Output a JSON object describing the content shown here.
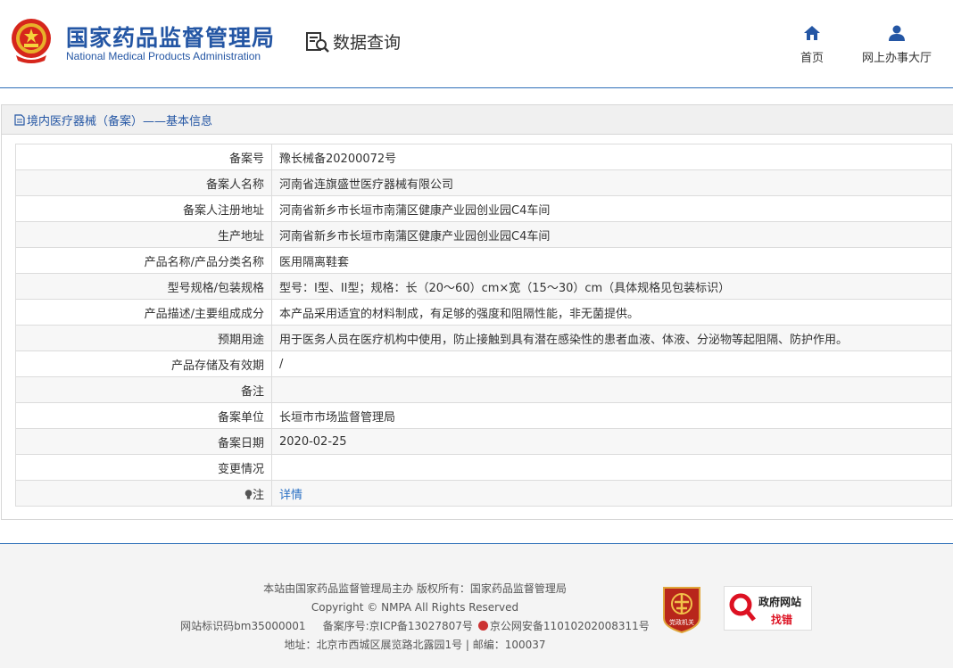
{
  "header": {
    "title_cn": "国家药品监督管理局",
    "title_en": "National Medical Products Administration",
    "query_label": "数据查询",
    "nav": [
      {
        "label": "首页",
        "icon": "home-icon"
      },
      {
        "label": "网上办事大厅",
        "icon": "user-icon"
      }
    ]
  },
  "panel": {
    "title": "境内医疗器械（备案）——基本信息",
    "rows": [
      {
        "label": "备案号",
        "value": "豫长械备20200072号"
      },
      {
        "label": "备案人名称",
        "value": "河南省连旗盛世医疗器械有限公司"
      },
      {
        "label": "备案人注册地址",
        "value": "河南省新乡市长垣市南蒲区健康产业园创业园C4车间"
      },
      {
        "label": "生产地址",
        "value": "河南省新乡市长垣市南蒲区健康产业园创业园C4车间"
      },
      {
        "label": "产品名称/产品分类名称",
        "value": "医用隔离鞋套"
      },
      {
        "label": "型号规格/包装规格",
        "value": "型号：I型、II型；规格：长（20～60）cm×宽（15～30）cm（具体规格见包装标识）"
      },
      {
        "label": "产品描述/主要组成成分",
        "value": "本产品采用适宜的材料制成，有足够的强度和阻隔性能，非无菌提供。"
      },
      {
        "label": "预期用途",
        "value": "用于医务人员在医疗机构中使用，防止接触到具有潜在感染性的患者血液、体液、分泌物等起阻隔、防护作用。"
      },
      {
        "label": "产品存储及有效期",
        "value": "/"
      },
      {
        "label": "备注",
        "value": ""
      },
      {
        "label": "备案单位",
        "value": "长垣市市场监督管理局"
      },
      {
        "label": "备案日期",
        "value": "2020-02-25"
      },
      {
        "label": "变更情况",
        "value": ""
      },
      {
        "label": "注",
        "value": "详情"
      }
    ]
  },
  "footer": {
    "line1": "本站由国家药品监督管理局主办 版权所有：国家药品监督管理局",
    "line2": "Copyright © NMPA All Rights Reserved",
    "site_id": "网站标识码bm35000001",
    "icp": "备案序号:京ICP备13027807号",
    "police": "京公网安备11010202008311号",
    "address": "地址：北京市西城区展览路北露园1号 | 邮编：100037",
    "badge1_text": "党政机关",
    "badge2_line1": "政府网站",
    "badge2_line2": "找错"
  },
  "colors": {
    "brand": "#2456a4",
    "link": "#2a70c4"
  }
}
